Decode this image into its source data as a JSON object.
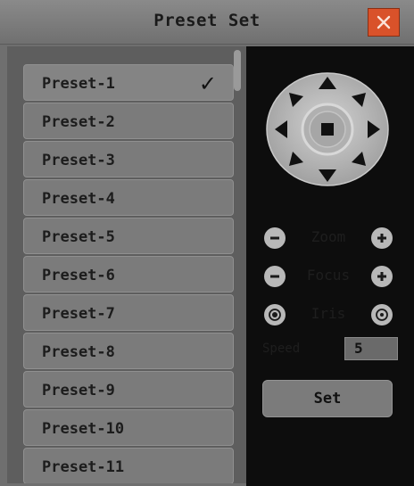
{
  "window": {
    "title": "Preset Set"
  },
  "icons": {
    "close": "close-icon",
    "check": "checkmark-icon",
    "ptz": "ptz-direction-pad"
  },
  "presets": [
    {
      "label": "Preset-1",
      "selected": true
    },
    {
      "label": "Preset-2"
    },
    {
      "label": "Preset-3"
    },
    {
      "label": "Preset-4"
    },
    {
      "label": "Preset-5"
    },
    {
      "label": "Preset-6"
    },
    {
      "label": "Preset-7"
    },
    {
      "label": "Preset-8"
    },
    {
      "label": "Preset-9"
    },
    {
      "label": "Preset-10"
    },
    {
      "label": "Preset-11"
    }
  ],
  "controls": {
    "zoom_label": "Zoom",
    "focus_label": "Focus",
    "iris_label": "Iris",
    "speed_label": "Speed",
    "speed_value": "5",
    "set_label": "Set"
  },
  "colors": {
    "close_bg": "#d9522a",
    "panel_dark": "#0d0d0d"
  }
}
